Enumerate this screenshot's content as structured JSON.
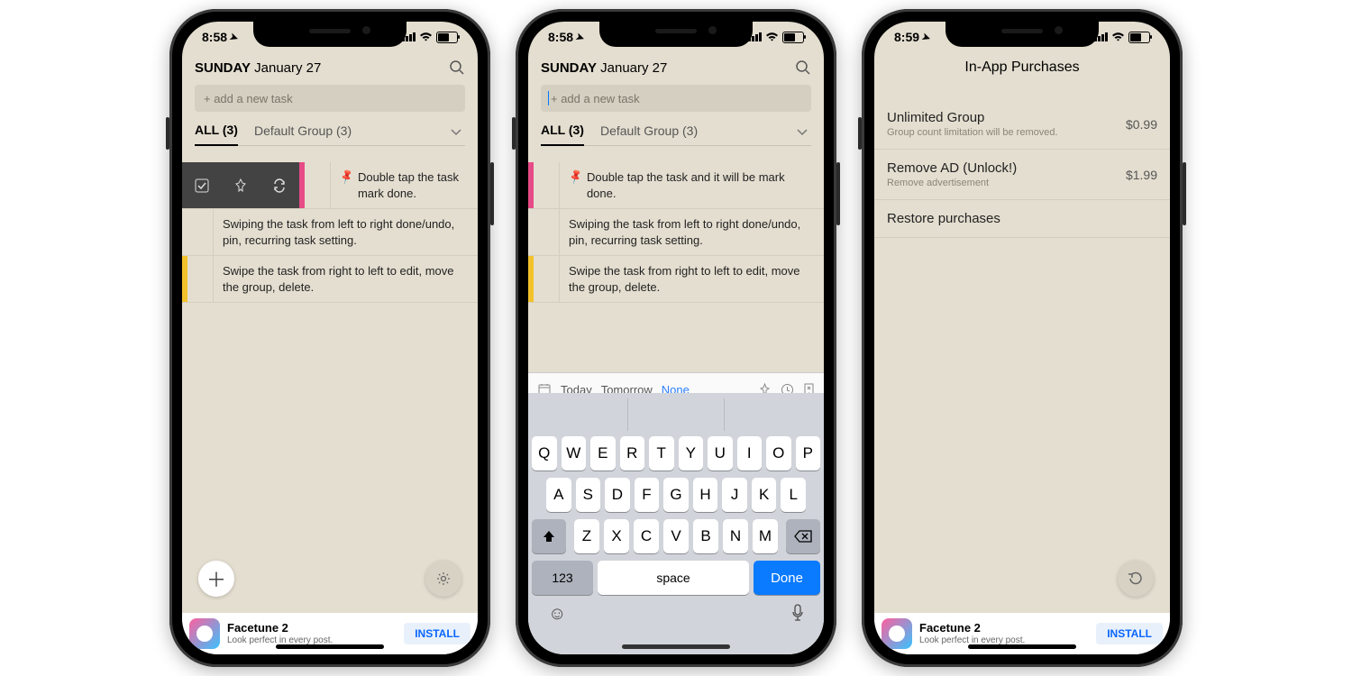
{
  "status": {
    "time1": "8:58",
    "time2": "8:58",
    "time3": "8:59"
  },
  "header": {
    "day": "SUNDAY",
    "date": "January 27",
    "search_icon": "search",
    "add_placeholder": "+ add a new task"
  },
  "tabs": {
    "all": "ALL (3)",
    "group": "Default Group (3)"
  },
  "tasks": [
    {
      "text": "Double tap the task and it will be mark done.",
      "pinned": true,
      "stripe": "#e74b86"
    },
    {
      "text": "Swiping the task from left to right done/undo, pin, recurring task setting.",
      "pinned": false,
      "stripe": "transparent"
    },
    {
      "text": "Swipe the task from right to left to edit, move the group, delete.",
      "pinned": false,
      "stripe": "#f3c22b"
    }
  ],
  "task1_short": "Double tap the task mark done.",
  "kb_toolbar": {
    "today": "Today",
    "tomorrow": "Tomorrow",
    "none": "None"
  },
  "kb": {
    "row1": [
      "Q",
      "W",
      "E",
      "R",
      "T",
      "Y",
      "U",
      "I",
      "O",
      "P"
    ],
    "row2": [
      "A",
      "S",
      "D",
      "F",
      "G",
      "H",
      "J",
      "K",
      "L"
    ],
    "row3": [
      "Z",
      "X",
      "C",
      "V",
      "B",
      "N",
      "M"
    ],
    "k123": "123",
    "space": "space",
    "done": "Done"
  },
  "iap": {
    "title": "In-App Purchases",
    "items": [
      {
        "title": "Unlimited Group",
        "sub": "Group count limitation will be removed.",
        "price": "$0.99"
      },
      {
        "title": "Remove AD (Unlock!)",
        "sub": "Remove advertisement",
        "price": "$1.99"
      }
    ],
    "restore": "Restore purchases"
  },
  "ad": {
    "title": "Facetune 2",
    "sub": "Look perfect in every post.",
    "btn": "INSTALL"
  }
}
